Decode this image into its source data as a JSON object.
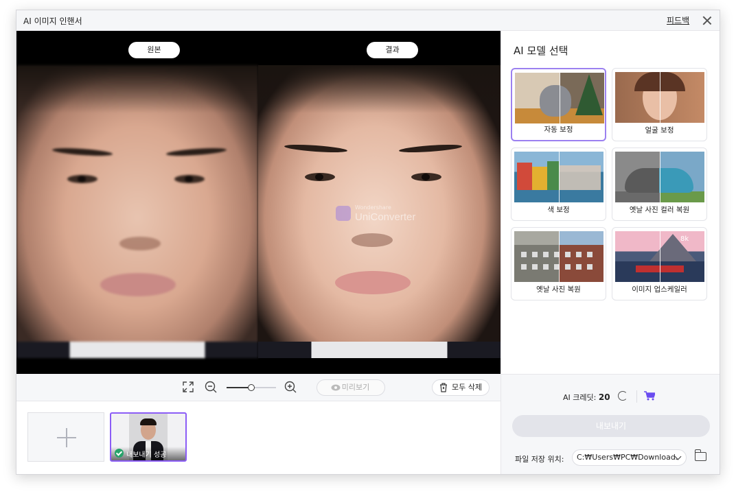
{
  "window": {
    "title": "AI 이미지 인핸서",
    "feedback_label": "피드백"
  },
  "preview": {
    "original_label": "원본",
    "result_label": "결과",
    "watermark_small": "Wondershare",
    "watermark_big": "UniConverter"
  },
  "toolbar": {
    "preview_label": "미리보기",
    "delete_all_label": "모두 삭제",
    "zoom_level": 0.5
  },
  "thumbnails": [
    {
      "status": "내보내기 성공"
    }
  ],
  "sidebar": {
    "title": "AI 모델 선택",
    "models": [
      {
        "label": "자동 보정",
        "selected": true
      },
      {
        "label": "얼굴 보정",
        "selected": false
      },
      {
        "label": "색 보정",
        "selected": false
      },
      {
        "label": "옛날 사진 컬러 복원",
        "selected": false
      },
      {
        "label": "옛날 사진 복원",
        "selected": false
      },
      {
        "label": "이미지 업스케일러",
        "selected": false
      }
    ],
    "upscale_badge": "8k",
    "credit_label": "AI 크레딧:",
    "credit_value": "20",
    "export_label": "내보내기",
    "save_location_label": "파일 저장 위치:",
    "save_path": "C:₩Users₩PC₩Downloads"
  },
  "colors": {
    "accent": "#8b5cf6",
    "success": "#27a36a",
    "cart": "#6a4cf0"
  }
}
